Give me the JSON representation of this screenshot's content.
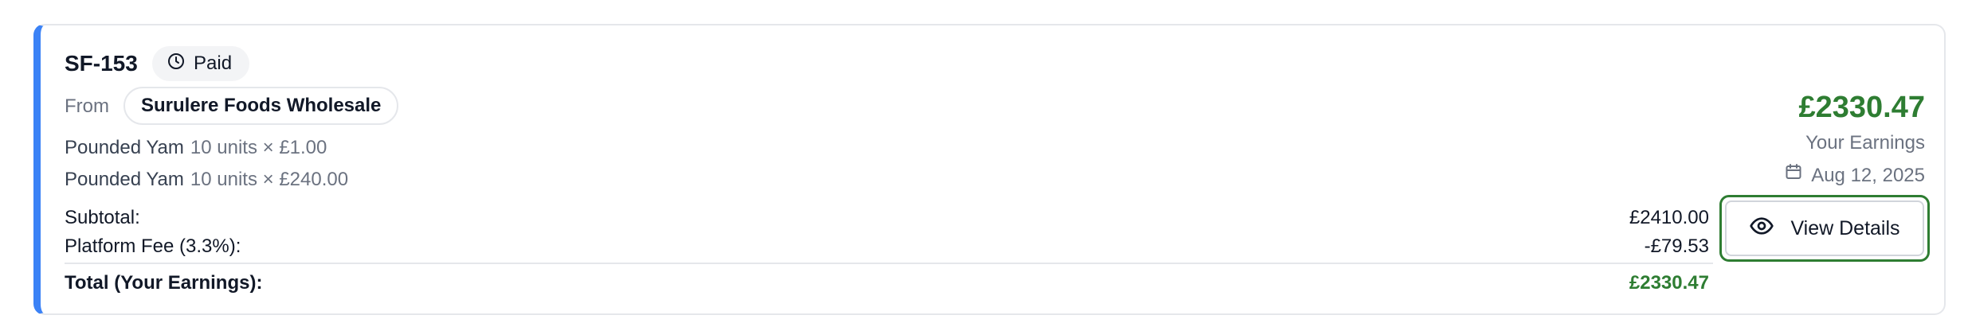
{
  "order": {
    "id": "SF-153",
    "status": "Paid",
    "from_label": "From",
    "supplier": "Surulere Foods Wholesale",
    "items": [
      {
        "name": "Pounded Yam",
        "detail": "10 units × £1.00"
      },
      {
        "name": "Pounded Yam",
        "detail": "10 units × £240.00"
      }
    ],
    "summary": {
      "subtotal_label": "Subtotal:",
      "subtotal_value": "£2410.00",
      "fee_label": "Platform Fee (3.3%):",
      "fee_value": "-£79.53",
      "total_label": "Total (Your Earnings):",
      "total_value": "£2330.47"
    },
    "earnings": {
      "amount": "£2330.47",
      "label": "Your Earnings",
      "date": "Aug 12, 2025"
    },
    "actions": {
      "view_details_label": "View Details"
    }
  },
  "icons": {
    "status": "clock-icon",
    "date": "calendar-icon",
    "view": "eye-icon"
  },
  "colors": {
    "accent_border": "#3b82f6",
    "earnings_green": "#2e7d32",
    "muted_text": "#6b7280",
    "badge_bg": "#f3f4f6"
  }
}
